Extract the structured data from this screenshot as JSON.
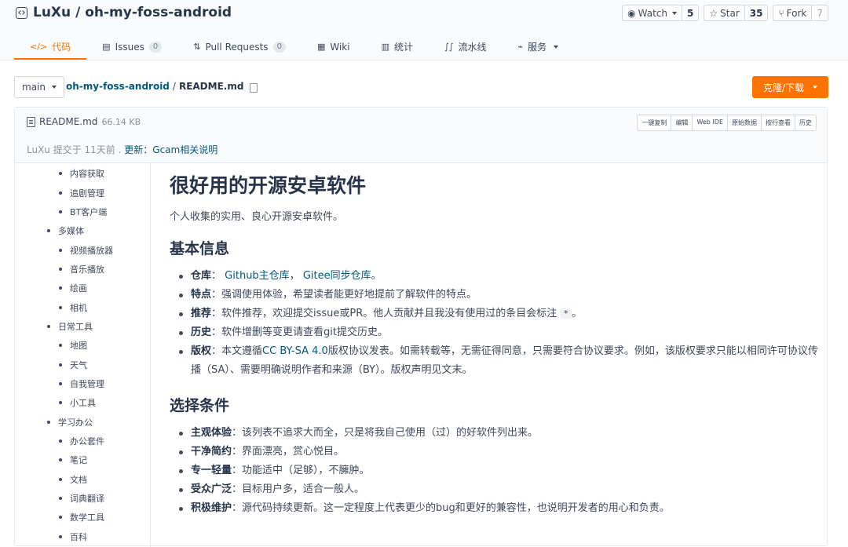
{
  "repo": {
    "owner": "LuXu",
    "separator": "/",
    "name": "oh-my-foss-android"
  },
  "actions": {
    "watch": {
      "label": "Watch",
      "count": "5"
    },
    "star": {
      "label": "Star",
      "count": "35"
    },
    "fork": {
      "label": "Fork",
      "count": "7"
    }
  },
  "tabs": [
    {
      "icon": "</>",
      "label": "代码"
    },
    {
      "icon": "▤",
      "label": "Issues",
      "badge": "0"
    },
    {
      "icon": "⇅",
      "label": "Pull Requests",
      "badge": "0"
    },
    {
      "icon": "▦",
      "label": "Wiki"
    },
    {
      "icon": "▥",
      "label": "统计"
    },
    {
      "icon": "∫∫",
      "label": "流水线"
    },
    {
      "icon": "⌁",
      "label": "服务"
    }
  ],
  "toolbar": {
    "branch": "main",
    "crumb_repo": "oh-my-foss-android",
    "crumb_sep": "/",
    "crumb_file": "README.md",
    "clone_label": "克隆/下载"
  },
  "file": {
    "name": "README.md",
    "size": "66.14 KB",
    "buttons": [
      "一键复制",
      "编辑",
      "Web IDE",
      "原始数据",
      "按行查看",
      "历史"
    ],
    "commit_prefix": "LuXu 提交于 11天前 .",
    "commit_link": "更新：Gcam相关说明"
  },
  "toc": [
    {
      "level": 2,
      "text": "内容获取"
    },
    {
      "level": 2,
      "text": "追剧管理"
    },
    {
      "level": 2,
      "text": "BT客户端"
    },
    {
      "level": 1,
      "text": "多媒体"
    },
    {
      "level": 2,
      "text": "视频播放器"
    },
    {
      "level": 2,
      "text": "音乐播放"
    },
    {
      "level": 2,
      "text": "绘画"
    },
    {
      "level": 2,
      "text": "相机"
    },
    {
      "level": 1,
      "text": "日常工具"
    },
    {
      "level": 2,
      "text": "地图"
    },
    {
      "level": 2,
      "text": "天气"
    },
    {
      "level": 2,
      "text": "自我管理"
    },
    {
      "level": 2,
      "text": "小工具"
    },
    {
      "level": 1,
      "text": "学习办公"
    },
    {
      "level": 2,
      "text": "办公套件"
    },
    {
      "level": 2,
      "text": "笔记"
    },
    {
      "level": 2,
      "text": "文档"
    },
    {
      "level": 2,
      "text": "词典翻译"
    },
    {
      "level": 2,
      "text": "数学工具"
    },
    {
      "level": 2,
      "text": "百科"
    }
  ],
  "readme": {
    "title": "很好用的开源安卓软件",
    "intro": "个人收集的实用、良心开源安卓软件。",
    "section1": "基本信息",
    "info": {
      "repo_label": "仓库",
      "repo_sep": "：",
      "repo_link1": "Github主仓库",
      "repo_mid": "，",
      "repo_link2": "Gitee同步仓库",
      "repo_end": "。",
      "feature_label": "特点",
      "feature_text": "：强调使用体验，希望读者能更好地提前了解软件的特点。",
      "recommend_label": "推荐",
      "recommend_text": "：软件推荐，欢迎提交issue或PR。他人贡献并且我没有使用过的条目会标注",
      "recommend_code": "*",
      "recommend_end": "。",
      "history_label": "历史",
      "history_text": "：软件增删等变更请查看git提交历史。",
      "license_label": "版权",
      "license_pre": "：本文遵循",
      "license_link": "CC BY-SA 4.0",
      "license_text": "版权协议发表。如需转载等，无需征得同意，只需要符合协议要求。例如，该版权要求只能以相同许可协议传播（SA）、需要明确说明作者和来源（BY）。版权声明见文末。"
    },
    "section2": "选择条件",
    "criteria": [
      {
        "label": "主观体验",
        "text": "：该列表不追求大而全，只是将我自己使用（过）的好软件列出来。"
      },
      {
        "label": "干净简约",
        "text": "：界面漂亮，赏心悦目。"
      },
      {
        "label": "专一轻量",
        "text": "：功能适中（足够），不臃肿。"
      },
      {
        "label": "受众广泛",
        "text": "：目标用户多，适合一般人。"
      },
      {
        "label": "积极维护",
        "text": "：源代码持续更新。这一定程度上代表更少的bug和更好的兼容性，也说明开发者的用心和负责。"
      }
    ]
  },
  "colors": {
    "accent": "#fe7300",
    "link": "#005980",
    "text": "#40485b"
  }
}
